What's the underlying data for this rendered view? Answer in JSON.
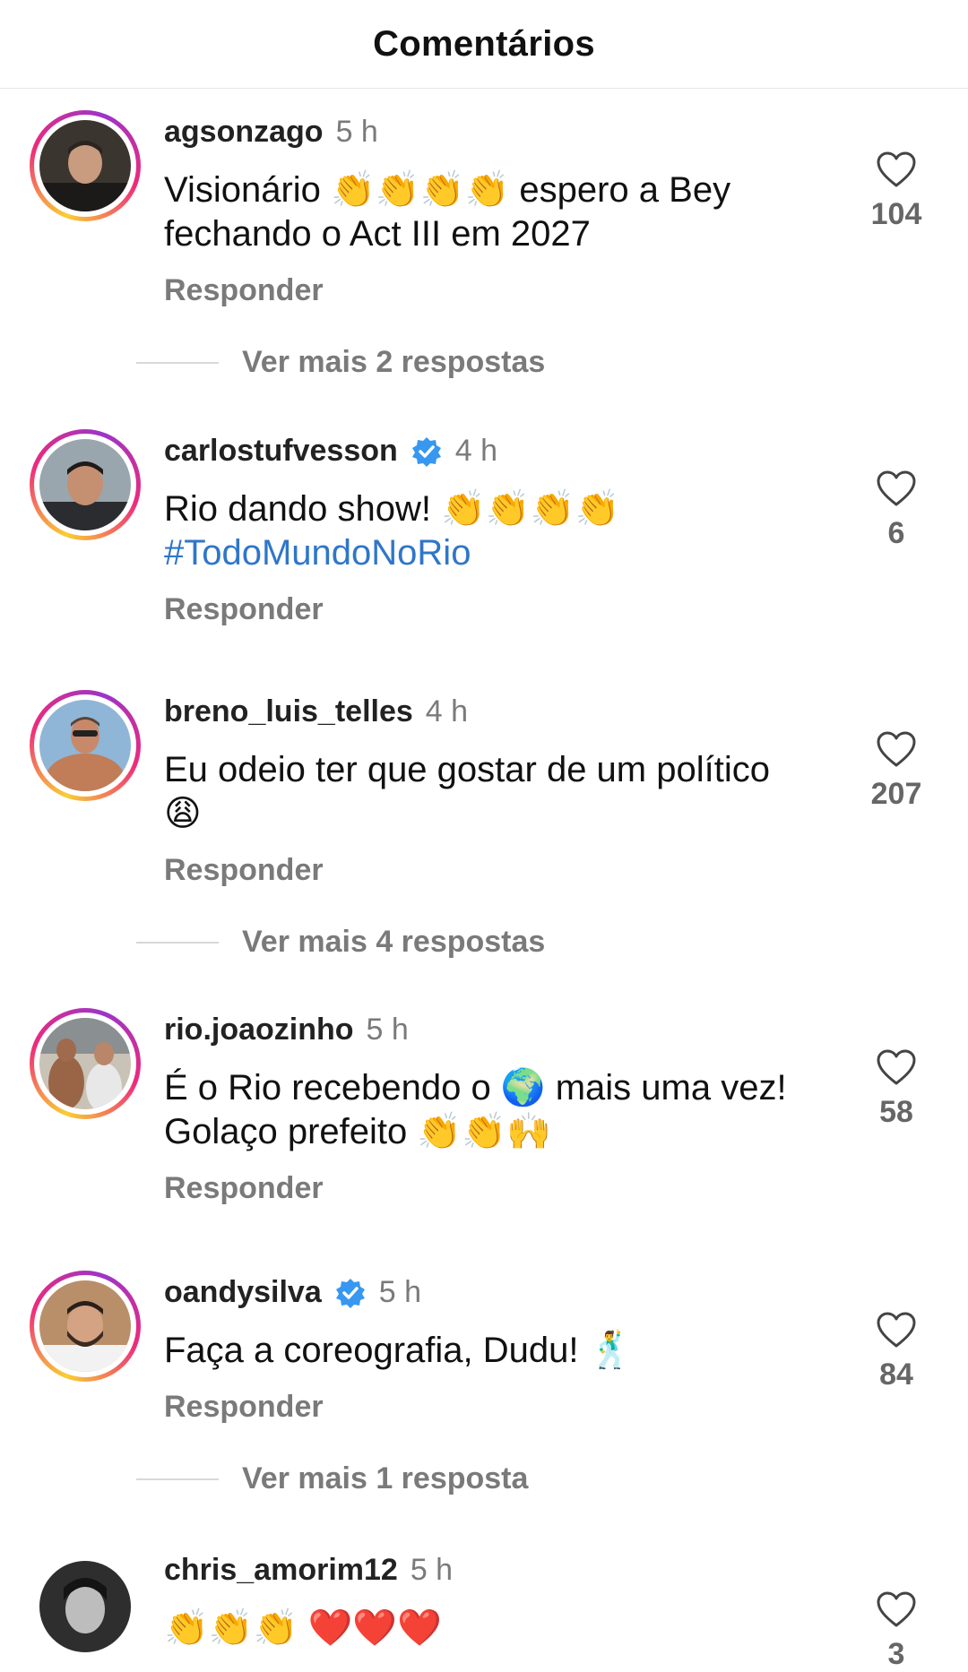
{
  "header": {
    "title": "Comentários"
  },
  "comments": [
    {
      "username": "agsonzago",
      "verified": false,
      "time": "5 h",
      "text": "Visionário 👏👏👏👏 espero a Bey fechando o Act III em 2027",
      "reply_label": "Responder",
      "likes": "104",
      "more_replies": "Ver mais 2 respostas"
    },
    {
      "username": "carlostufvesson",
      "verified": true,
      "time": "4 h",
      "text": "Rio dando show! 👏👏👏👏",
      "hashtag": "#TodoMundoNoRio",
      "reply_label": "Responder",
      "likes": "6"
    },
    {
      "username": "breno_luis_telles",
      "verified": false,
      "time": "4 h",
      "text": "Eu odeio ter que gostar de um político 😩",
      "reply_label": "Responder",
      "likes": "207",
      "more_replies": "Ver mais 4 respostas"
    },
    {
      "username": "rio.joaozinho",
      "verified": false,
      "time": "5 h",
      "text": "É o Rio recebendo o 🌍 mais uma vez! Golaço prefeito 👏👏🙌",
      "reply_label": "Responder",
      "likes": "58"
    },
    {
      "username": "oandysilva",
      "verified": true,
      "time": "5 h",
      "text": "Faça a coreografia, Dudu! 🕺",
      "reply_label": "Responder",
      "likes": "84",
      "more_replies": "Ver mais 1 resposta"
    },
    {
      "username": "chris_amorim12",
      "verified": false,
      "time": "5 h",
      "text": "👏👏👏 ❤️❤️❤️",
      "likes": "3"
    }
  ],
  "icons": {
    "like": "heart-outline-icon",
    "verified": "verified-badge-icon"
  },
  "colors": {
    "hashtag": "#2f76c9",
    "verified": "#3897f0",
    "secondary_text": "#7a7a7a"
  }
}
